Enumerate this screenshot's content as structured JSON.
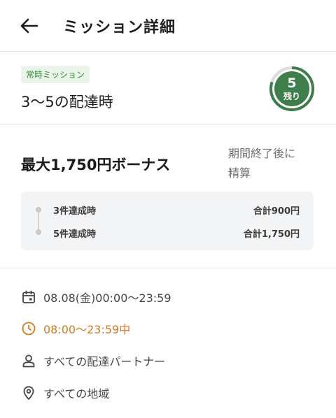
{
  "header": {
    "title": "ミッション詳細"
  },
  "mission": {
    "tag": "常時ミッション",
    "name": "3〜5の配達時",
    "remaining_count": "5",
    "remaining_label": "残り",
    "remaining_fraction": 0.8
  },
  "bonus": {
    "title": "最大1,750円ボーナス",
    "settle_note_line1": "期間終了後に",
    "settle_note_line2": "精算",
    "tiers": [
      {
        "label": "3件達成時",
        "amount": "合計900円"
      },
      {
        "label": "5件達成時",
        "amount": "合計1,750円"
      }
    ]
  },
  "info": {
    "date": "08.08(金)00:00〜23:59",
    "time": "08:00〜23:59中",
    "target": "すべての配達パートナー",
    "area": "すべての地域"
  },
  "colors": {
    "badge_green": "#3e7e4b",
    "badge_ring": "#dcdcdc",
    "tag_bg": "#e8f5e8",
    "tag_text": "#3a8a3a",
    "active_orange": "#d17a22"
  }
}
